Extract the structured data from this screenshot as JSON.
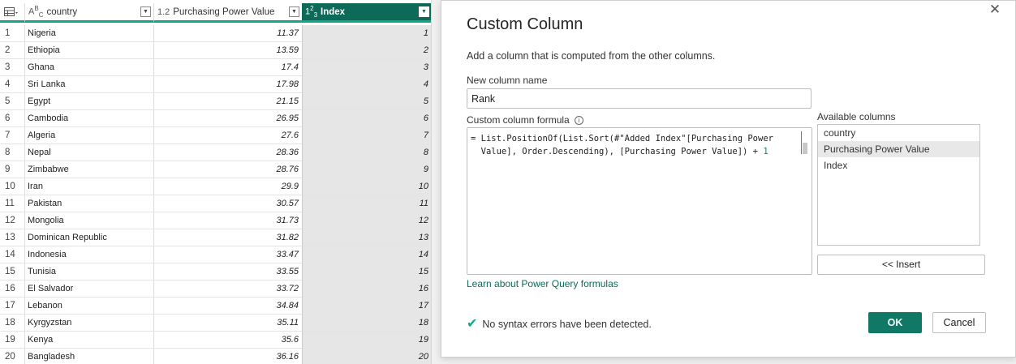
{
  "grid": {
    "headers": {
      "country": {
        "type": "ABC",
        "label": "country"
      },
      "ppv": {
        "type": "1.2",
        "label": "Purchasing Power Value"
      },
      "index": {
        "type": "123",
        "label": "Index"
      }
    },
    "rows": [
      {
        "num": "1",
        "country": "Nigeria",
        "ppv": "11.37",
        "index": "1"
      },
      {
        "num": "2",
        "country": "Ethiopia",
        "ppv": "13.59",
        "index": "2"
      },
      {
        "num": "3",
        "country": "Ghana",
        "ppv": "17.4",
        "index": "3"
      },
      {
        "num": "4",
        "country": "Sri Lanka",
        "ppv": "17.98",
        "index": "4"
      },
      {
        "num": "5",
        "country": "Egypt",
        "ppv": "21.15",
        "index": "5"
      },
      {
        "num": "6",
        "country": "Cambodia",
        "ppv": "26.95",
        "index": "6"
      },
      {
        "num": "7",
        "country": "Algeria",
        "ppv": "27.6",
        "index": "7"
      },
      {
        "num": "8",
        "country": "Nepal",
        "ppv": "28.36",
        "index": "8"
      },
      {
        "num": "9",
        "country": "Zimbabwe",
        "ppv": "28.76",
        "index": "9"
      },
      {
        "num": "10",
        "country": "Iran",
        "ppv": "29.9",
        "index": "10"
      },
      {
        "num": "11",
        "country": "Pakistan",
        "ppv": "30.57",
        "index": "11"
      },
      {
        "num": "12",
        "country": "Mongolia",
        "ppv": "31.73",
        "index": "12"
      },
      {
        "num": "13",
        "country": "Dominican Republic",
        "ppv": "31.82",
        "index": "13"
      },
      {
        "num": "14",
        "country": "Indonesia",
        "ppv": "33.47",
        "index": "14"
      },
      {
        "num": "15",
        "country": "Tunisia",
        "ppv": "33.55",
        "index": "15"
      },
      {
        "num": "16",
        "country": "El Salvador",
        "ppv": "33.72",
        "index": "16"
      },
      {
        "num": "17",
        "country": "Lebanon",
        "ppv": "34.84",
        "index": "17"
      },
      {
        "num": "18",
        "country": "Kyrgyzstan",
        "ppv": "35.11",
        "index": "18"
      },
      {
        "num": "19",
        "country": "Kenya",
        "ppv": "35.6",
        "index": "19"
      },
      {
        "num": "20",
        "country": "Bangladesh",
        "ppv": "36.16",
        "index": "20"
      }
    ]
  },
  "dialog": {
    "title": "Custom Column",
    "subtitle": "Add a column that is computed from the other columns.",
    "new_column_name_label": "New column name",
    "new_column_name_value": "Rank",
    "formula_label": "Custom column formula",
    "formula_line1": "= List.PositionOf(List.Sort(#\"Added Index\"[Purchasing Power",
    "formula_line2_main": "  Value], Order.Descending), [Purchasing Power Value]) + ",
    "formula_line2_num": "1",
    "available_columns_label": "Available columns",
    "available_columns": [
      "country",
      "Purchasing Power Value",
      "Index"
    ],
    "selected_column": "Purchasing Power Value",
    "insert_label": "<< Insert",
    "learn_link": "Learn about Power Query formulas",
    "status_text": "No syntax errors have been detected.",
    "ok_label": "OK",
    "cancel_label": "Cancel"
  },
  "colors": {
    "accent": "#117865",
    "header_underline": "#17a589",
    "index_header_bg": "#0e6a58",
    "index_column_bg": "#e6e6e6"
  }
}
